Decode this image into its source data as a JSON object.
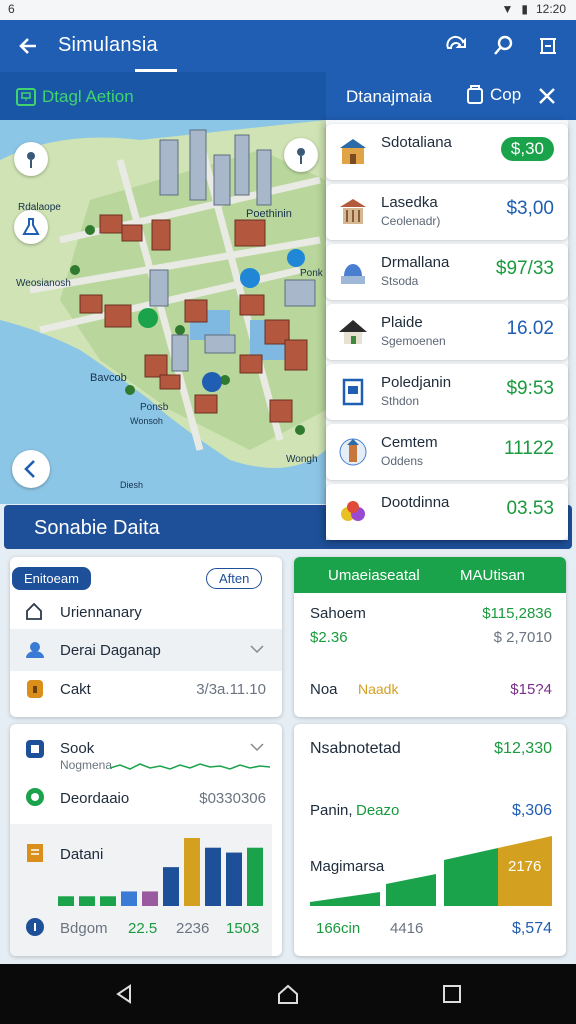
{
  "status": {
    "left": "6",
    "right": "12:20"
  },
  "appbar": {
    "title": "Simulansia"
  },
  "subbar": {
    "action_label": "Dtagl Aetion"
  },
  "detail_panel": {
    "title": "Dtanajmaia",
    "copy_label": "Cop",
    "items": [
      {
        "name": "Sdotaliana",
        "sub": "",
        "value": "$,30",
        "style": "badge"
      },
      {
        "name": "Lasedka",
        "sub": "Ceolenadr)",
        "value": "$3,00",
        "style": "blue"
      },
      {
        "name": "Drmallana",
        "sub": "Stsoda",
        "value": "$97/33",
        "style": "green"
      },
      {
        "name": "Plaide",
        "sub": "Sgemoenen",
        "value": "16.02",
        "style": "blue"
      },
      {
        "name": "Poledjanin",
        "sub": "Sthdon",
        "value": "$9:53",
        "style": "green"
      },
      {
        "name": "Cemtem",
        "sub": "Oddens",
        "value": "11122",
        "style": "green"
      },
      {
        "name": "Dootdinna",
        "sub": "",
        "value": "03.53",
        "style": "green"
      }
    ]
  },
  "map": {
    "labels": [
      "Rdalaope",
      "Poethinin",
      "Weosianosh",
      "Ponk",
      "Bavcob",
      "Ponsb",
      "Wongh",
      "Wonsoh",
      "Diesh"
    ]
  },
  "section_title": "Sonabie Daita",
  "card1": {
    "badge": "Enitoeam",
    "button": "Aften",
    "rows": [
      "Uriennanary",
      "Derai Daganap",
      "Cakt"
    ],
    "cakt_value": "3/3a.11.10"
  },
  "card2": {
    "header_left": "Umaeiaseatal",
    "header_right": "MAUtisan",
    "r1_label": "Sahoem",
    "r1_value": "$115,2836",
    "r2_label": "$2.36",
    "r2_value": "$ 2,7010",
    "r3_label": "Noa",
    "r3_accent": "Naadk",
    "r3_value": "$15?4"
  },
  "card3": {
    "r1": "Sook",
    "r1_sub": "Nogmena",
    "r2": "Deordaaio",
    "r2_value": "$0330306",
    "r3": "Datani",
    "bottom_label": "Bdgom",
    "bottom_v1": "22.5",
    "bottom_v2": "2236",
    "bottom_v3": "1503",
    "bar_values": [
      2,
      2,
      2,
      3,
      3,
      8,
      14,
      12,
      11,
      12
    ]
  },
  "card4": {
    "title": "Nsabnotetad",
    "title_value": "$12,330",
    "r2_label": "Panin,",
    "r2_accent": "Deazo",
    "r2_value": "$,306",
    "r3_label": "Magimarsa",
    "area_value": "2176",
    "bottom_label": "166cin",
    "bottom_mid": "4416",
    "bottom_value": "$,574"
  },
  "colors": {
    "primary": "#1f5eb3",
    "green": "#1aa34a",
    "gold": "#d4a020"
  }
}
